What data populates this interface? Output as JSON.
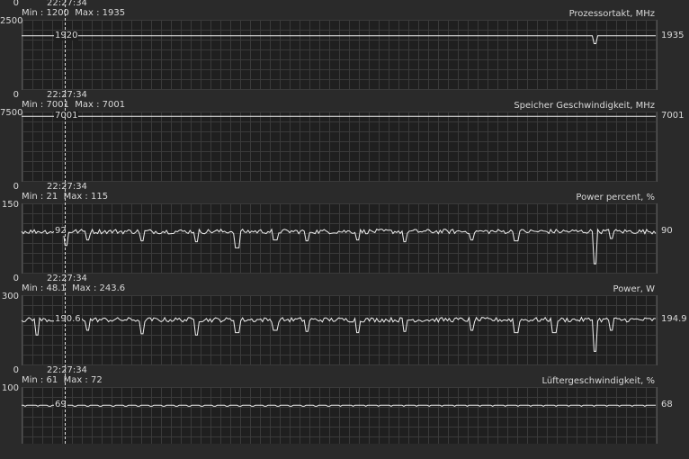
{
  "cursor_time": "22:27:34",
  "graphs": [
    {
      "title": "Prozessortakt, MHz",
      "y_max": "2500",
      "y_min": "0",
      "min_label": "Min : 1200",
      "max_label": "Max : 1935",
      "value_at_cursor": "1920",
      "current_value": "1935",
      "range": [
        0,
        2500
      ],
      "trace": {
        "kind": "flat",
        "base": 1930,
        "noise": 3,
        "dips": [
          [
            0.905,
            1650,
            2
          ]
        ]
      }
    },
    {
      "title": "Speicher Geschwindigkeit, MHz",
      "y_max": "7500",
      "y_min": "0",
      "min_label": "Min : 7001",
      "max_label": "Max : 7001",
      "value_at_cursor": "7001",
      "current_value": "7001",
      "range": [
        0,
        7500
      ],
      "trace": {
        "kind": "flat",
        "base": 7001,
        "noise": 0,
        "dips": []
      }
    },
    {
      "title": "Power percent, %",
      "y_max": "150",
      "y_min": "0",
      "min_label": "Min : 21",
      "max_label": "Max : 115",
      "value_at_cursor": "92",
      "current_value": "90",
      "range": [
        0,
        150
      ],
      "trace": {
        "kind": "noisy",
        "base": 90,
        "noise": 5,
        "dips": [
          [
            0.07,
            60,
            1
          ],
          [
            0.105,
            72,
            1
          ],
          [
            0.19,
            70,
            1
          ],
          [
            0.275,
            68,
            1
          ],
          [
            0.34,
            55,
            1
          ],
          [
            0.4,
            72,
            1
          ],
          [
            0.45,
            70,
            1
          ],
          [
            0.53,
            72,
            1
          ],
          [
            0.605,
            68,
            1
          ],
          [
            0.71,
            72,
            1
          ],
          [
            0.78,
            70,
            1
          ],
          [
            0.905,
            21,
            1
          ],
          [
            0.93,
            75,
            1
          ]
        ]
      }
    },
    {
      "title": "Power, W",
      "y_max": "300",
      "y_min": "0",
      "min_label": "Min : 48.1",
      "max_label": "Max : 243.6",
      "value_at_cursor": "190.6",
      "current_value": "194.9",
      "range": [
        0,
        300
      ],
      "trace": {
        "kind": "noisy",
        "base": 195,
        "noise": 10,
        "dips": [
          [
            0.025,
            130,
            1
          ],
          [
            0.105,
            150,
            1
          ],
          [
            0.19,
            135,
            1
          ],
          [
            0.275,
            130,
            1
          ],
          [
            0.34,
            140,
            1
          ],
          [
            0.4,
            150,
            1
          ],
          [
            0.45,
            145,
            1
          ],
          [
            0.53,
            140,
            1
          ],
          [
            0.605,
            145,
            1
          ],
          [
            0.71,
            150,
            1
          ],
          [
            0.78,
            140,
            1
          ],
          [
            0.84,
            140,
            1
          ],
          [
            0.905,
            60,
            1
          ],
          [
            0.93,
            150,
            1
          ]
        ]
      }
    },
    {
      "title": "Lüftergeschwindigkeit, %",
      "y_max": "100",
      "y_min": "0",
      "min_label": "Min : 61",
      "max_label": "Max : 72",
      "value_at_cursor": "69",
      "current_value": "68",
      "range": [
        0,
        100
      ],
      "trace": {
        "kind": "steps",
        "base": 68,
        "noise": 0.6,
        "dips": []
      }
    }
  ]
}
